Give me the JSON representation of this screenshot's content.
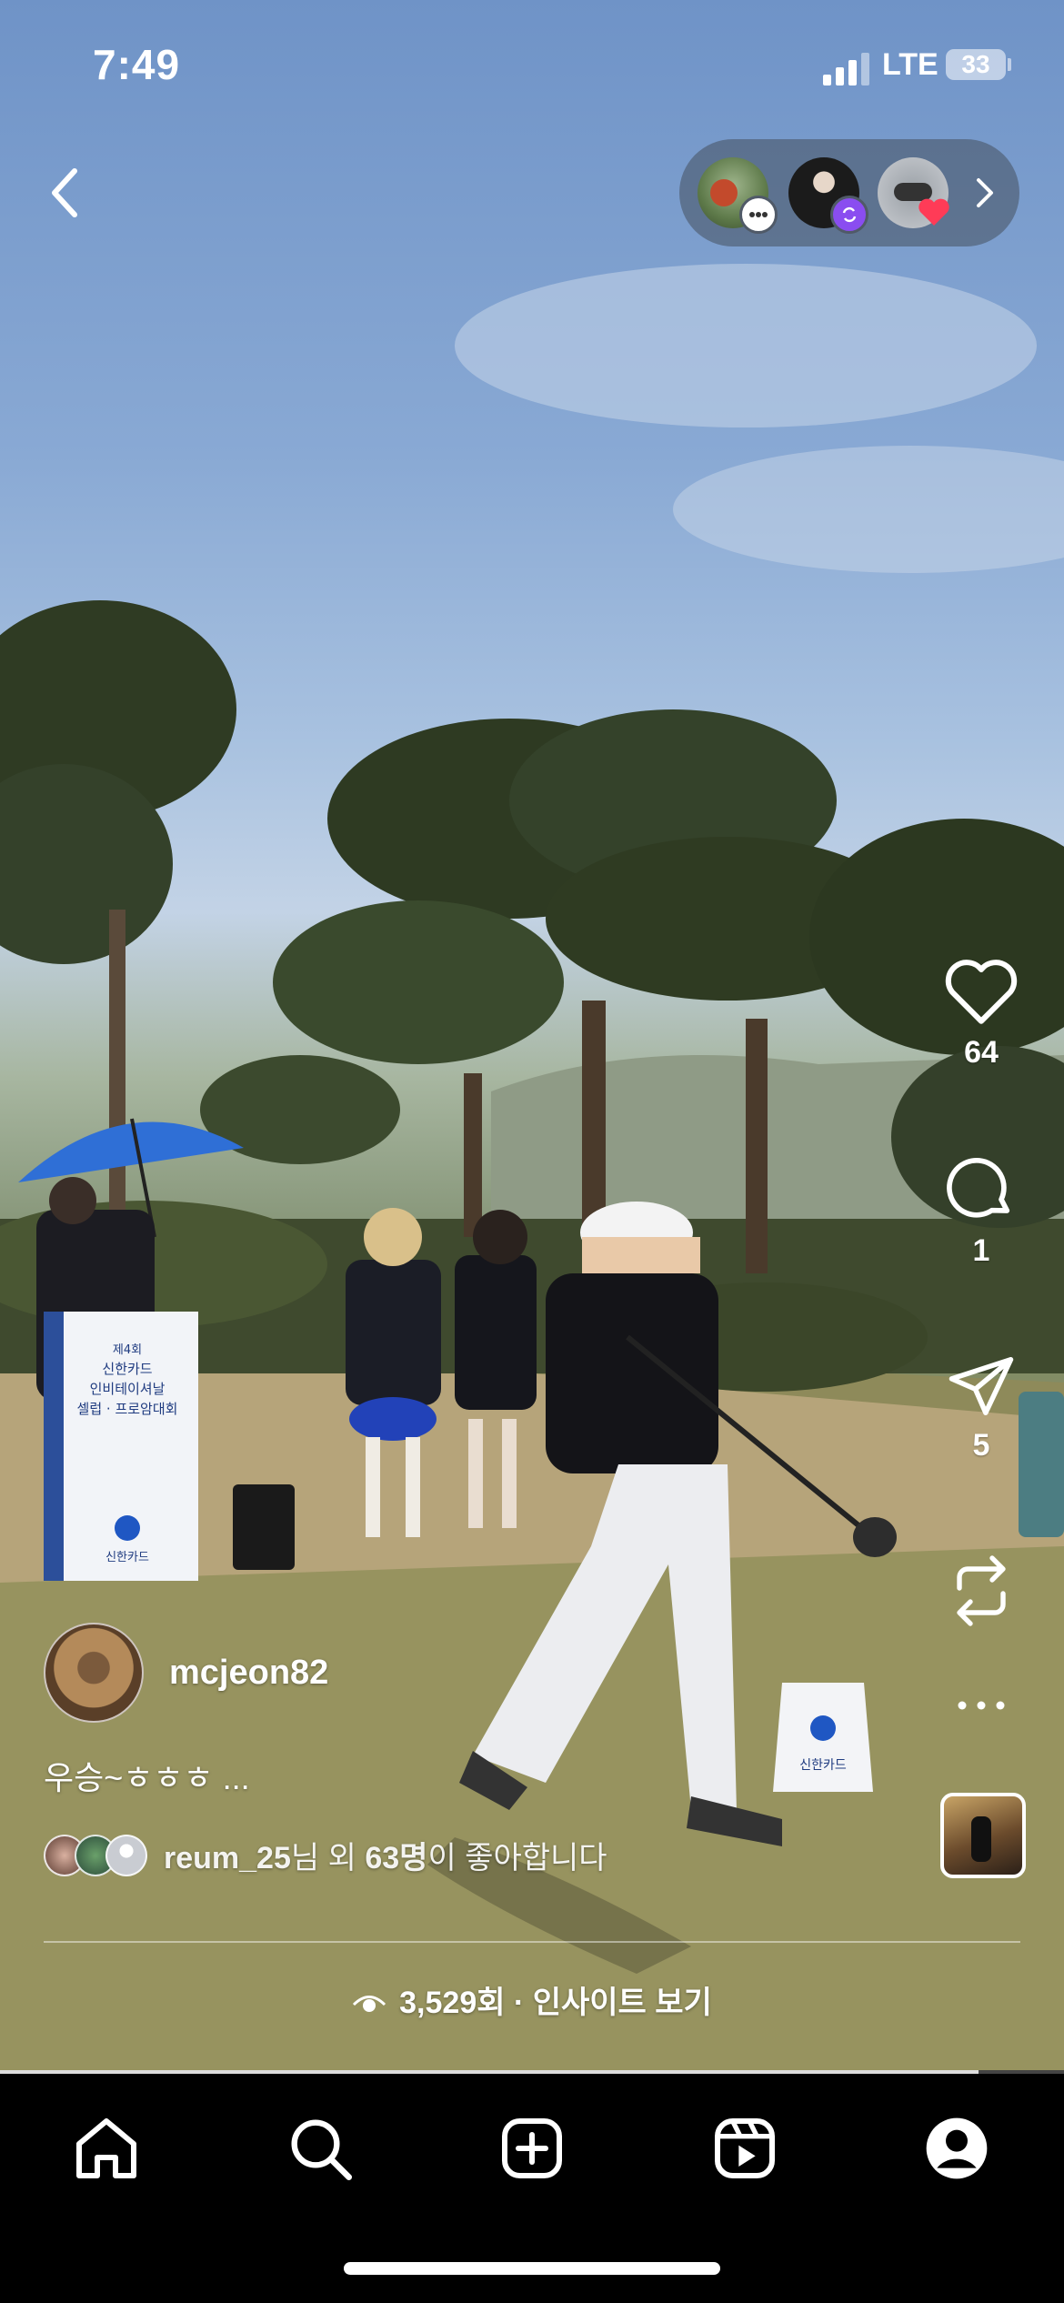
{
  "status_bar": {
    "time": "7:49",
    "network": "LTE",
    "battery": "33"
  },
  "post": {
    "username": "mcjeon82",
    "caption": "우승~ㅎㅎㅎ ...",
    "likes": {
      "user": "reum_25",
      "suffix_1": "님 외 ",
      "count": "63명",
      "suffix_2": "이 좋아합니다"
    },
    "views": "3,529회 · 인사이트 보기",
    "progress": 0.92
  },
  "actions": {
    "like_count": "64",
    "comment_count": "1",
    "share_count": "5"
  },
  "scene_signage": {
    "podium_line1": "제4회",
    "podium_line2": "신한카드",
    "podium_line3": "인비테이셔날",
    "podium_line4": "셀럽 · 프로암대회",
    "podium_brand": "신한카드",
    "tee_brand": "신한카드"
  },
  "tabs": [
    "home-icon",
    "search-icon",
    "create-icon",
    "reels-icon",
    "profile-icon"
  ]
}
